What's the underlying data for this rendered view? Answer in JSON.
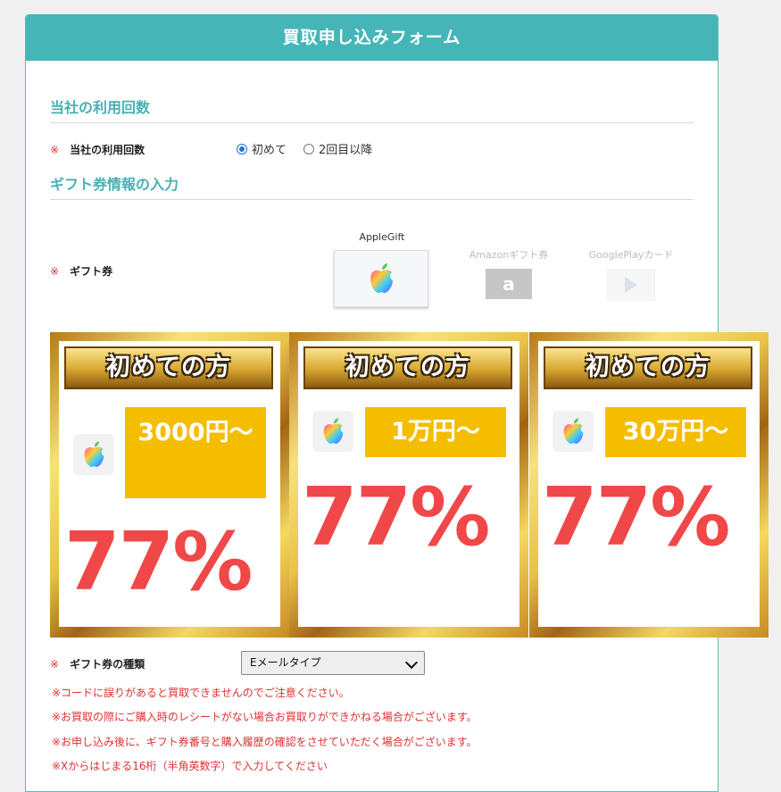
{
  "form": {
    "title": "買取申し込みフォーム"
  },
  "section_usage": {
    "title": "当社の利用回数",
    "required_mark": "※",
    "label": "当社の利用回数",
    "options": [
      {
        "label": "初めて",
        "selected": true
      },
      {
        "label": "2回目以降",
        "selected": false
      }
    ]
  },
  "section_gift": {
    "title": "ギフト券情報の入力",
    "required_mark": "※",
    "label": "ギフト券",
    "cards": [
      {
        "label": "AppleGift",
        "icon": "apple-gift-card-icon",
        "selected": true
      },
      {
        "label": "Amazonギフト券",
        "icon": "amazon-logo-icon",
        "selected": false
      },
      {
        "label": "GooglePlayカード",
        "icon": "google-play-icon",
        "selected": false
      }
    ]
  },
  "banners": [
    {
      "heading": "初めての方",
      "amount": "3000円〜",
      "rate": "77%"
    },
    {
      "heading": "初めての方",
      "amount": "1万円〜",
      "rate": "77%"
    },
    {
      "heading": "初めての方",
      "amount": "30万円〜",
      "rate": "77%"
    }
  ],
  "gift_type": {
    "required_mark": "※",
    "label": "ギフト券の種類",
    "selected": "Eメールタイプ"
  },
  "notes": [
    "※コードに誤りがあると買取できませんのでご注意ください。",
    "※お買取の際にご購入時のレシートがない場合お買取りができかねる場合がございます。",
    "※お申し込み後に、ギフト券番号と購入履歴の確認をさせていただく場合がございます。",
    "※Xからはじまる16桁（半角英数字）で入力してください"
  ],
  "colors": {
    "header": "#45b5b8",
    "section_title": "#4ab0b3",
    "required": "#e03030",
    "rate": "#f04848",
    "amount_bg": "#f5bd00"
  }
}
